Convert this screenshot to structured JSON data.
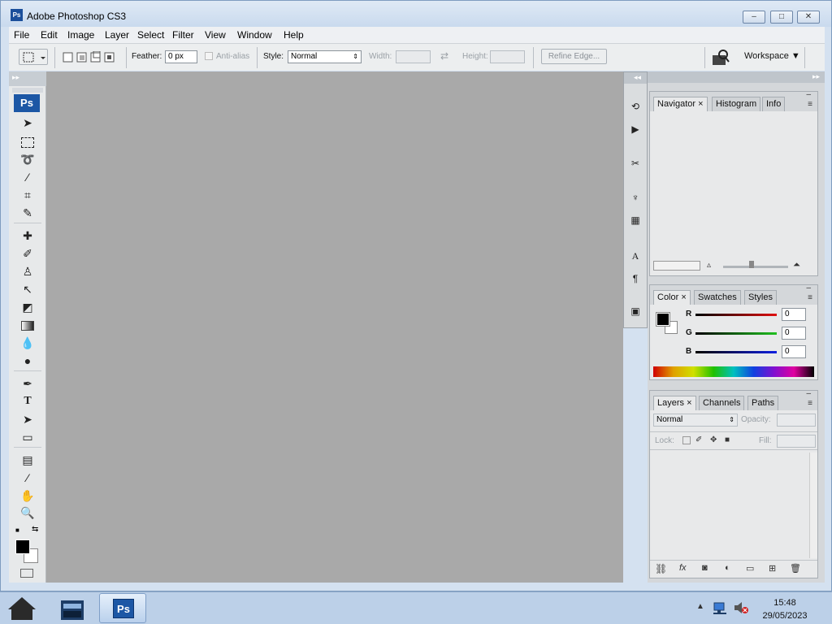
{
  "window": {
    "title": "Adobe Photoshop CS3",
    "app_icon_text": "Ps",
    "controls": {
      "minimize": "–",
      "maximize": "□",
      "close": "✕"
    }
  },
  "menubar": [
    "File",
    "Edit",
    "Image",
    "Layer",
    "Select",
    "Filter",
    "View",
    "Window",
    "Help"
  ],
  "options_bar": {
    "feather_label": "Feather:",
    "feather_value": "0 px",
    "antialias_label": "Anti-alias",
    "style_label": "Style:",
    "style_value": "Normal",
    "width_label": "Width:",
    "height_label": "Height:",
    "refine_edge_label": "Refine Edge...",
    "workspace_label": "Workspace ▼"
  },
  "toolbox": {
    "logo_text": "Ps"
  },
  "panels": {
    "group1_tabs": [
      "Navigator",
      "Histogram",
      "Info"
    ],
    "group2_tabs": [
      "Color",
      "Swatches",
      "Styles"
    ],
    "group3_tabs": [
      "Layers",
      "Channels",
      "Paths"
    ],
    "color": {
      "r_label": "R",
      "g_label": "G",
      "b_label": "B",
      "r_value": "0",
      "g_value": "0",
      "b_value": "0"
    },
    "layers": {
      "blend_mode": "Normal",
      "opacity_label": "Opacity:",
      "lock_label": "Lock:",
      "fill_label": "Fill:"
    }
  },
  "taskbar": {
    "ps_label": "Ps",
    "time": "15:48",
    "date": "29/05/2023"
  },
  "colors": {
    "canvas_bg": "#a9a9a9",
    "titlebar": "#d4e1f0",
    "ps_blue": "#1c57a5"
  }
}
